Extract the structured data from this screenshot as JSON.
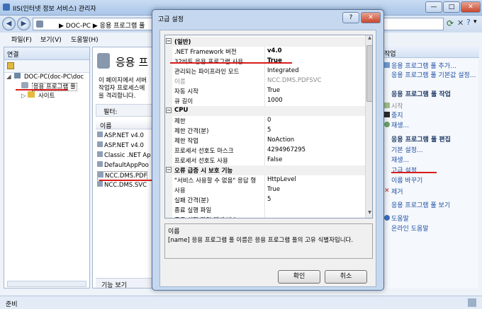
{
  "window": {
    "title": "IIS(인터넷 정보 서비스) 관리자",
    "controls": {
      "minimize": "—",
      "maximize": "□",
      "close": "✕"
    }
  },
  "address": {
    "back": "◀",
    "forward": "▶",
    "path": "▶  DOC-PC  ▶  응용 프로그램 풀",
    "dropdown": "▾"
  },
  "menu": [
    "파일(F)",
    "보기(V)",
    "도움말(H)"
  ],
  "connections": {
    "header": "연결",
    "tree": [
      {
        "label": "DOC-PC(doc-PC\\doc",
        "level": 0
      },
      {
        "label": "응용 프로그램 풀",
        "level": 1
      },
      {
        "label": "사이트",
        "level": 1
      }
    ]
  },
  "middle": {
    "heading": "응용 프",
    "description_lines": [
      "이 페이지에서 서버",
      "작업자 프로세스에",
      "을 격리합니다."
    ],
    "filter_label": "필터:",
    "column_name": "이름",
    "pools": [
      "ASP.NET v4.0",
      "ASP.NET v4.0",
      "Classic .NET Ap",
      "DefaultAppPoo",
      "NCC.DMS.PDF",
      "NCC.DMS.SVC"
    ],
    "view_tab": "기능 보기"
  },
  "actions": {
    "header": "작업",
    "items": [
      {
        "label": "응용 프로그램 풀 추가...",
        "type": "link"
      },
      {
        "label": "응용 프로그램 풀 기본값 설정...",
        "type": "link"
      },
      {
        "label": "응용 프로그램 풀 작업",
        "type": "head"
      },
      {
        "label": "시작",
        "type": "dis"
      },
      {
        "label": "중지",
        "type": "link"
      },
      {
        "label": "재생...",
        "type": "link"
      },
      {
        "label": "응용 프로그램 풀 편집",
        "type": "head"
      },
      {
        "label": "기본 설정...",
        "type": "link"
      },
      {
        "label": "재생...",
        "type": "link"
      },
      {
        "label": "고급 설정...",
        "type": "link"
      },
      {
        "label": "이름 바꾸기",
        "type": "link"
      },
      {
        "label": "제거",
        "type": "link"
      },
      {
        "label": "응용 프로그램 풀 보기",
        "type": "link"
      },
      {
        "label": "도움말",
        "type": "link"
      },
      {
        "label": "온라인 도움말",
        "type": "link"
      }
    ]
  },
  "status": {
    "text": "준비"
  },
  "dialog": {
    "title": "고급 설정",
    "help": "?",
    "close": "✕",
    "categories": [
      {
        "name": "(일반)",
        "toggle": "⊟",
        "rows": [
          {
            "key": ".NET Framework 버전",
            "value": "v4.0",
            "bold": true
          },
          {
            "key": "32비트 응용 프로그램 사용",
            "value": "True",
            "bold": true
          },
          {
            "key": "관리되는 파이프라인 모드",
            "value": "Integrated",
            "bold": false
          },
          {
            "key": "이름",
            "value": "NCC.DMS.PDFSVC",
            "dim": true
          },
          {
            "key": "자동 시작",
            "value": "True",
            "bold": false
          },
          {
            "key": "큐 길이",
            "value": "1000",
            "bold": false
          }
        ]
      },
      {
        "name": "CPU",
        "toggle": "⊟",
        "rows": [
          {
            "key": "제한",
            "value": "0",
            "bold": false
          },
          {
            "key": "제한 간격(분)",
            "value": "5",
            "bold": false
          },
          {
            "key": "제한 작업",
            "value": "NoAction",
            "bold": false
          },
          {
            "key": "프로세서 선호도 마스크",
            "value": "4294967295",
            "bold": false
          },
          {
            "key": "프로세서 선호도 사용",
            "value": "False",
            "bold": false
          }
        ]
      },
      {
        "name": "오류 급증 시 보호 기능",
        "toggle": "⊟",
        "rows": [
          {
            "key": "\"서비스 사용할 수 없음\" 응답 형",
            "value": "HttpLevel",
            "bold": false
          },
          {
            "key": "사용",
            "value": "True",
            "bold": false
          },
          {
            "key": "실패 간격(분)",
            "value": "5",
            "bold": false
          },
          {
            "key": "종료 실행 파일",
            "value": "",
            "bold": false
          },
          {
            "key": "종료 실행 파일 매개 변수",
            "value": "",
            "bold": false
          }
        ]
      }
    ],
    "description_title": "이름",
    "description_text": "[name] 응용 프로그램 풀 이름은 응용 프로그램 풀의 고유 식별자입니다.",
    "ok": "확인",
    "cancel": "취소"
  },
  "colors": {
    "annotation": "#d81c1c",
    "link": "#1f4fa3"
  }
}
